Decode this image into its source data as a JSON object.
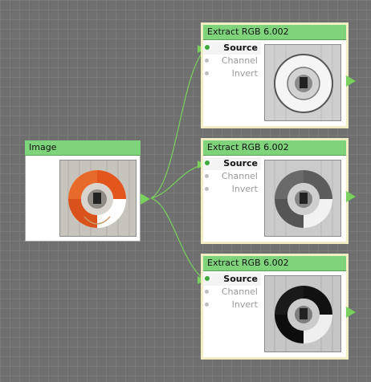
{
  "canvas": {
    "background": "#6f6f6f",
    "wire_color": "#79d05c",
    "header_color": "#7fd37a"
  },
  "image_node": {
    "title": "Image",
    "preview": "color-life-ring-thumbnail"
  },
  "extract_nodes": [
    {
      "title": "Extract RGB 6.002",
      "ports": [
        {
          "label": "Source",
          "state": "connected"
        },
        {
          "label": "Channel",
          "state": "idle"
        },
        {
          "label": "Invert",
          "state": "idle"
        }
      ],
      "preview": "red-channel-thumbnail"
    },
    {
      "title": "Extract RGB 6.002",
      "ports": [
        {
          "label": "Source",
          "state": "connected"
        },
        {
          "label": "Channel",
          "state": "idle"
        },
        {
          "label": "Invert",
          "state": "idle"
        }
      ],
      "preview": "green-channel-thumbnail"
    },
    {
      "title": "Extract RGB 6.002",
      "ports": [
        {
          "label": "Source",
          "state": "connected"
        },
        {
          "label": "Channel",
          "state": "idle"
        },
        {
          "label": "Invert",
          "state": "idle"
        }
      ],
      "preview": "blue-channel-thumbnail"
    }
  ]
}
